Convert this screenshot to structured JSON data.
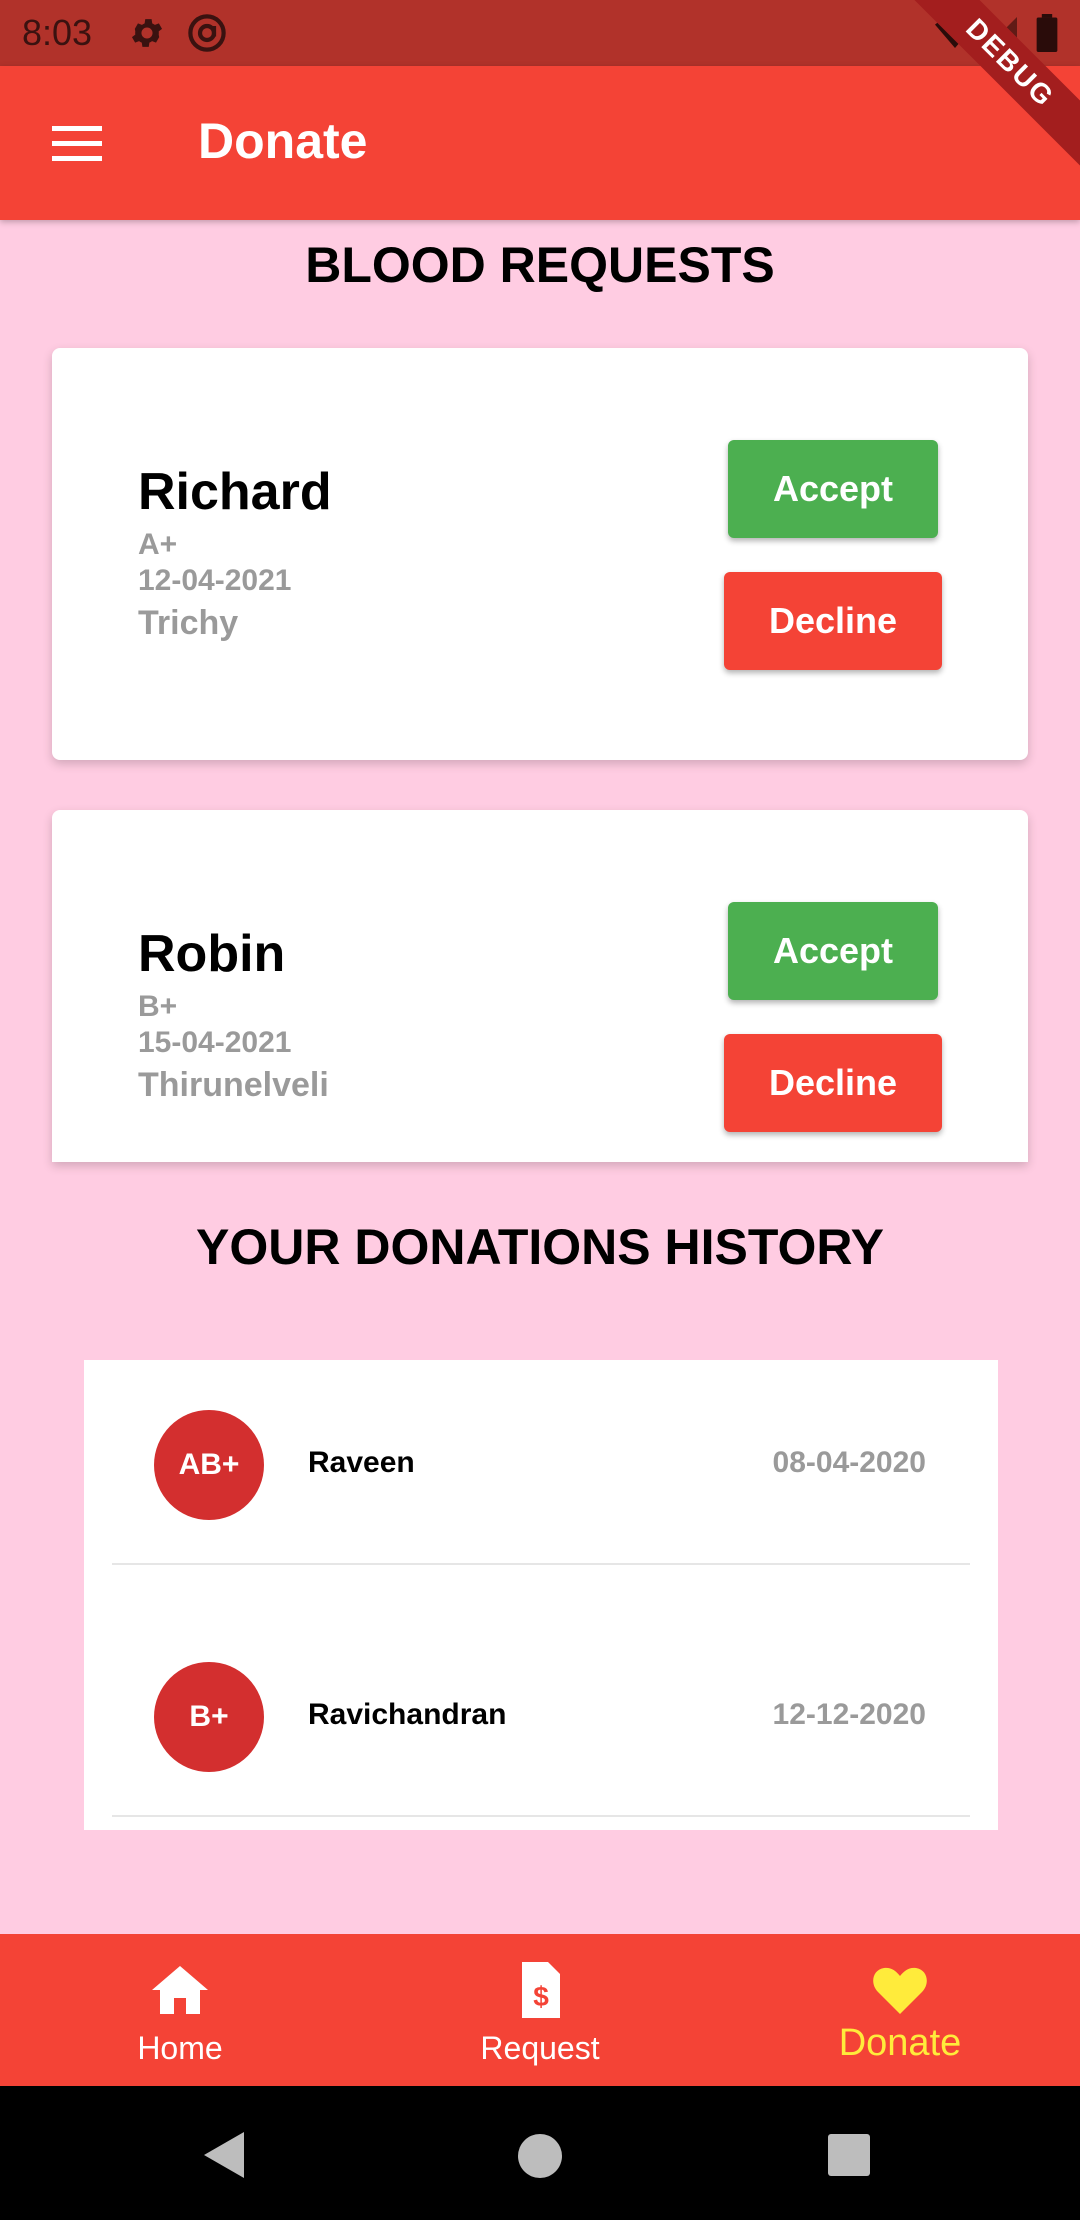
{
  "status_bar": {
    "time": "8:03",
    "icons": [
      "gear-icon",
      "at-sign-icon",
      "wifi-icon",
      "signal-icon",
      "battery-icon"
    ]
  },
  "debug_banner": "DEBUG",
  "app_bar": {
    "title": "Donate",
    "menu_icon": "hamburger-menu-icon",
    "background": "#f44336"
  },
  "requests": {
    "title": "BLOOD REQUESTS",
    "items": [
      {
        "name": "Richard",
        "blood_group": "A+",
        "date": "12-04-2021",
        "city": "Trichy",
        "accept_label": "Accept",
        "decline_label": "Decline"
      },
      {
        "name": "Robin",
        "blood_group": "B+",
        "date": "15-04-2021",
        "city": "Thirunelveli",
        "accept_label": "Accept",
        "decline_label": "Decline"
      }
    ]
  },
  "history": {
    "title": "YOUR DONATIONS HISTORY",
    "items": [
      {
        "blood_group": "AB+",
        "name": "Raveen",
        "date": "08-04-2020"
      },
      {
        "blood_group": "B+",
        "name": "Ravichandran",
        "date": "12-12-2020"
      }
    ]
  },
  "bottom_nav": {
    "items": [
      {
        "label": "Home",
        "icon": "home-icon"
      },
      {
        "label": "Request",
        "icon": "dollar-document-icon"
      },
      {
        "label": "Donate",
        "icon": "heart-icon",
        "selected": true
      }
    ],
    "active_color": "#ffeb3b"
  },
  "colors": {
    "page_background": "#ffcce2",
    "accept": "#4caf50",
    "decline": "#f44336",
    "avatar": "#d32f2f"
  }
}
